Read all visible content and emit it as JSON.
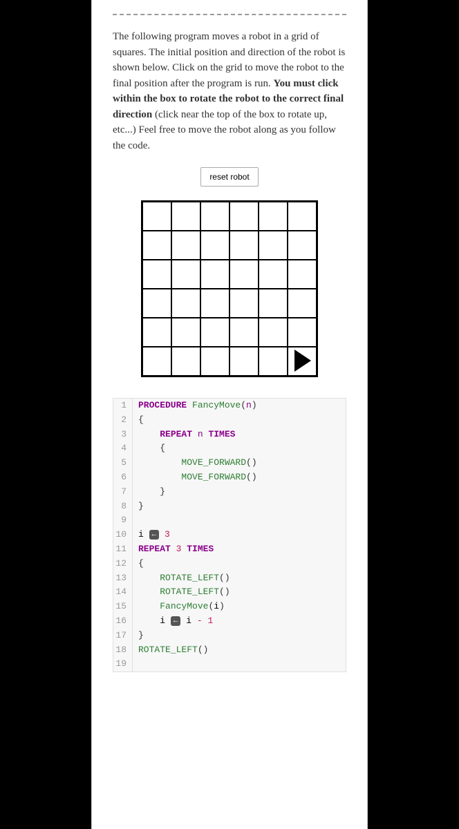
{
  "description": {
    "p1": "The following program moves a robot in a grid of squares. The initial position and direction of the robot is shown below. Click on the grid to move the robot to the final position after the program is run. ",
    "bold": "You must click within the box to rotate the robot to the correct final direction",
    "p2": " (click near the top of the box to rotate up, etc...) Feel free to move the robot along as you follow the code."
  },
  "reset_label": "reset robot",
  "grid": {
    "rows": 6,
    "cols": 6,
    "robot_row": 5,
    "robot_col": 5,
    "robot_direction": "right"
  },
  "code": {
    "lines": [
      {
        "n": "1",
        "indent": 0,
        "parts": [
          {
            "t": "kw",
            "v": "PROCEDURE "
          },
          {
            "t": "fn",
            "v": "FancyMove"
          },
          {
            "t": "paren",
            "v": "("
          },
          {
            "t": "param",
            "v": "n"
          },
          {
            "t": "paren",
            "v": ")"
          }
        ]
      },
      {
        "n": "2",
        "indent": 0,
        "parts": [
          {
            "t": "brace",
            "v": "{"
          }
        ]
      },
      {
        "n": "3",
        "indent": 1,
        "parts": [
          {
            "t": "kw",
            "v": "REPEAT "
          },
          {
            "t": "param",
            "v": "n"
          },
          {
            "t": "kw",
            "v": " TIMES"
          }
        ]
      },
      {
        "n": "4",
        "indent": 1,
        "parts": [
          {
            "t": "brace",
            "v": "{"
          }
        ]
      },
      {
        "n": "5",
        "indent": 2,
        "parts": [
          {
            "t": "fn",
            "v": "MOVE_FORWARD"
          },
          {
            "t": "paren",
            "v": "()"
          }
        ]
      },
      {
        "n": "6",
        "indent": 2,
        "parts": [
          {
            "t": "fn",
            "v": "MOVE_FORWARD"
          },
          {
            "t": "paren",
            "v": "()"
          }
        ]
      },
      {
        "n": "7",
        "indent": 1,
        "parts": [
          {
            "t": "brace",
            "v": "}"
          }
        ]
      },
      {
        "n": "8",
        "indent": 0,
        "parts": [
          {
            "t": "brace",
            "v": "}"
          }
        ]
      },
      {
        "n": "9",
        "indent": 0,
        "parts": []
      },
      {
        "n": "10",
        "indent": 0,
        "parts": [
          {
            "t": "plain",
            "v": "i "
          },
          {
            "t": "arrow",
            "v": "←"
          },
          {
            "t": "plain",
            "v": " "
          },
          {
            "t": "num",
            "v": "3"
          }
        ]
      },
      {
        "n": "11",
        "indent": 0,
        "parts": [
          {
            "t": "kw",
            "v": "REPEAT "
          },
          {
            "t": "num",
            "v": "3"
          },
          {
            "t": "kw",
            "v": " TIMES"
          }
        ]
      },
      {
        "n": "12",
        "indent": 0,
        "parts": [
          {
            "t": "brace",
            "v": "{"
          }
        ]
      },
      {
        "n": "13",
        "indent": 1,
        "parts": [
          {
            "t": "fn",
            "v": "ROTATE_LEFT"
          },
          {
            "t": "paren",
            "v": "()"
          }
        ]
      },
      {
        "n": "14",
        "indent": 1,
        "parts": [
          {
            "t": "fn",
            "v": "ROTATE_LEFT"
          },
          {
            "t": "paren",
            "v": "()"
          }
        ]
      },
      {
        "n": "15",
        "indent": 1,
        "parts": [
          {
            "t": "fn",
            "v": "FancyMove"
          },
          {
            "t": "paren",
            "v": "("
          },
          {
            "t": "plain",
            "v": "i"
          },
          {
            "t": "paren",
            "v": ")"
          }
        ]
      },
      {
        "n": "16",
        "indent": 1,
        "parts": [
          {
            "t": "plain",
            "v": "i "
          },
          {
            "t": "arrow",
            "v": "←"
          },
          {
            "t": "plain",
            "v": " i "
          },
          {
            "t": "op",
            "v": "-"
          },
          {
            "t": "plain",
            "v": " "
          },
          {
            "t": "num",
            "v": "1"
          }
        ]
      },
      {
        "n": "17",
        "indent": 0,
        "parts": [
          {
            "t": "brace",
            "v": "}"
          }
        ]
      },
      {
        "n": "18",
        "indent": 0,
        "parts": [
          {
            "t": "fn",
            "v": "ROTATE_LEFT"
          },
          {
            "t": "paren",
            "v": "()"
          }
        ]
      },
      {
        "n": "19",
        "indent": 0,
        "parts": []
      }
    ]
  }
}
